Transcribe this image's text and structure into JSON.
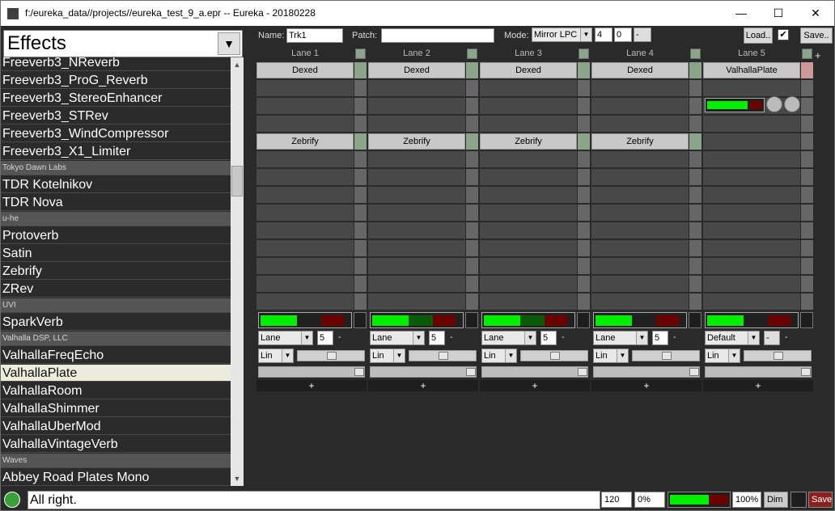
{
  "window": {
    "title": "f:/eureka_data//projects//eureka_test_9_a.epr -- Eureka - 20180228",
    "controls": {
      "minimize": "—",
      "maximize": "☐",
      "close": "✕"
    }
  },
  "effects_panel": {
    "category": "Effects",
    "items": [
      {
        "label": "Freeverb3_NReverb",
        "type": "item"
      },
      {
        "label": "Freeverb3_ProG_Reverb",
        "type": "item"
      },
      {
        "label": "Freeverb3_StereoEnhancer",
        "type": "item"
      },
      {
        "label": "Freeverb3_STRev",
        "type": "item"
      },
      {
        "label": "Freeverb3_WindCompressor",
        "type": "item"
      },
      {
        "label": "Freeverb3_X1_Limiter",
        "type": "item"
      },
      {
        "label": "Tokyo Dawn Labs",
        "type": "group"
      },
      {
        "label": "TDR Kotelnikov",
        "type": "item"
      },
      {
        "label": "TDR Nova",
        "type": "item"
      },
      {
        "label": "u-he",
        "type": "group"
      },
      {
        "label": "Protoverb",
        "type": "item"
      },
      {
        "label": "Satin",
        "type": "item"
      },
      {
        "label": "Zebrify",
        "type": "item"
      },
      {
        "label": "ZRev",
        "type": "item"
      },
      {
        "label": "UVI",
        "type": "group"
      },
      {
        "label": "SparkVerb",
        "type": "item"
      },
      {
        "label": "Valhalla DSP, LLC",
        "type": "group"
      },
      {
        "label": "ValhallaFreqEcho",
        "type": "item"
      },
      {
        "label": "ValhallaPlate",
        "type": "item",
        "selected": true
      },
      {
        "label": "ValhallaRoom",
        "type": "item"
      },
      {
        "label": "ValhallaShimmer",
        "type": "item"
      },
      {
        "label": "ValhallaUberMod",
        "type": "item"
      },
      {
        "label": "ValhallaVintageVerb",
        "type": "item"
      },
      {
        "label": "Waves",
        "type": "group"
      },
      {
        "label": "Abbey Road Plates Mono",
        "type": "item"
      }
    ]
  },
  "topbar": {
    "name_label": "Name:",
    "name_value": "Trk1",
    "patch_label": "Patch:",
    "patch_value": "",
    "mode_label": "Mode:",
    "mode_value": "Mirror LPC",
    "field_a": "4",
    "field_b": "0",
    "field_c": "-",
    "load_label": "Load..",
    "checkbox_checked": true,
    "save_label": "Save.."
  },
  "lanes": [
    {
      "title": "Lane 1",
      "slot1": "Dexed",
      "slot2": "Zebrify",
      "routing": "Lane",
      "routing_num": "5",
      "curve": "Lin",
      "meter_level": 0.72,
      "pan": 0.5
    },
    {
      "title": "Lane 2",
      "slot1": "Dexed",
      "slot2": "Zebrify",
      "routing": "Lane",
      "routing_num": "5",
      "curve": "Lin",
      "meter_level": 0.72,
      "pan": 0.5
    },
    {
      "title": "Lane 3",
      "slot1": "Dexed",
      "slot2": "Zebrify",
      "routing": "Lane",
      "routing_num": "5",
      "curve": "Lin",
      "meter_level": 0.72,
      "pan": 0.5
    },
    {
      "title": "Lane 4",
      "slot1": "Dexed",
      "slot2": "Zebrify",
      "routing": "Lane",
      "routing_num": "5",
      "curve": "Lin",
      "meter_level": 0.72,
      "pan": 0.5
    },
    {
      "title": "Lane 5",
      "slot1": "ValhallaPlate",
      "slot2": "",
      "routing": "Default",
      "routing_num": "-",
      "curve": "Lin",
      "meter_level": 0.72,
      "pan": 0.5
    }
  ],
  "lane_dash": "-",
  "add_lane_label": "+",
  "add_row_label": "+",
  "statusbar": {
    "message": "All right.",
    "bpm": "120",
    "cpu": "0%",
    "volume": "100%",
    "dim_label": "Dim",
    "save_label": "Save"
  },
  "colors": {
    "meter_green": "#00ee00",
    "meter_red": "#6a0000",
    "slot_bg": "#c8c8c8"
  }
}
